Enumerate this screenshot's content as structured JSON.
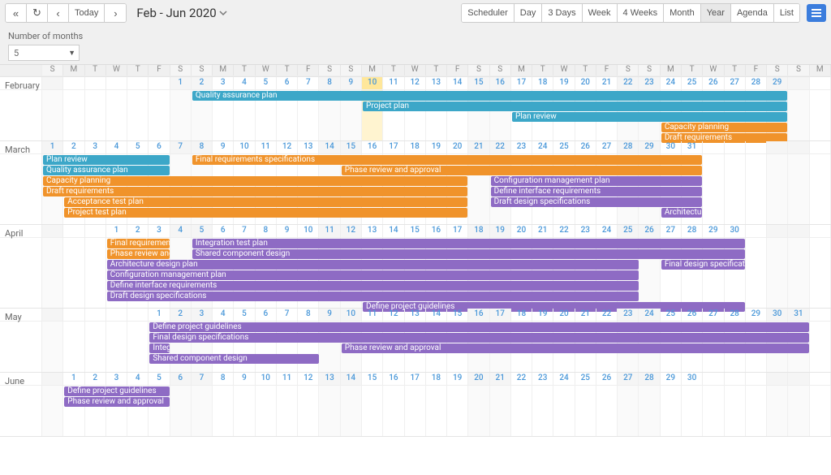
{
  "header": {
    "nav": {
      "first": "«",
      "prev": "‹",
      "today": "Today",
      "next": "›",
      "refresh": "↻"
    },
    "date_range": "Feb - Jun 2020",
    "views": [
      "Scheduler",
      "Day",
      "3 Days",
      "Week",
      "4 Weeks",
      "Month",
      "Year",
      "Agenda",
      "List"
    ],
    "active_view": "Year"
  },
  "subheader": {
    "label": "Number of months",
    "value": "5"
  },
  "weekdays": [
    "S",
    "M",
    "T",
    "W",
    "T",
    "F",
    "S"
  ],
  "colors": {
    "blue": "#3ca7c8",
    "orange": "#f0932b",
    "purple": "#8e6bc4",
    "today": "#ffe79a"
  },
  "months": [
    {
      "name": "February",
      "first_weekday": 6,
      "days": 29,
      "today": 10,
      "body_height": 62,
      "events": [
        {
          "label": "Quality assurance plan",
          "color": "blue",
          "start": 2,
          "end": 29,
          "row": 0
        },
        {
          "label": "Project plan",
          "color": "blue",
          "start": 10,
          "end": 29,
          "row": 1
        },
        {
          "label": "Plan review",
          "color": "blue",
          "start": 17,
          "end": 29,
          "row": 2
        },
        {
          "label": "Capacity planning",
          "color": "orange",
          "start": 24,
          "end": 29,
          "row": 3
        },
        {
          "label": "Draft requirements",
          "color": "orange",
          "start": 24,
          "end": 29,
          "row": 4
        }
      ]
    },
    {
      "name": "March",
      "first_weekday": 0,
      "days": 31,
      "today": null,
      "body_height": 86,
      "events": [
        {
          "label": "Plan review",
          "color": "blue",
          "start": 1,
          "end": 6,
          "row": 0
        },
        {
          "label": "Final requirements specifications",
          "color": "orange",
          "start": 8,
          "end": 31,
          "row": 0
        },
        {
          "label": "Quality assurance plan",
          "color": "blue",
          "start": 1,
          "end": 6,
          "row": 1
        },
        {
          "label": "Phase review and approval",
          "color": "orange",
          "start": 15,
          "end": 31,
          "row": 1
        },
        {
          "label": "Capacity planning",
          "color": "orange",
          "start": 1,
          "end": 20,
          "row": 2
        },
        {
          "label": "Configuration management plan",
          "color": "purple",
          "start": 22,
          "end": 31,
          "row": 2
        },
        {
          "label": "Draft requirements",
          "color": "orange",
          "start": 1,
          "end": 20,
          "row": 3
        },
        {
          "label": "Define interface requirements",
          "color": "purple",
          "start": 22,
          "end": 31,
          "row": 3
        },
        {
          "label": "Acceptance test plan",
          "color": "orange",
          "start": 2,
          "end": 20,
          "row": 4
        },
        {
          "label": "Draft design specifications",
          "color": "purple",
          "start": 22,
          "end": 31,
          "row": 4
        },
        {
          "label": "Project test plan",
          "color": "orange",
          "start": 2,
          "end": 20,
          "row": 5
        },
        {
          "label": "Architecture",
          "color": "purple",
          "start": 30,
          "end": 31,
          "row": 5
        }
      ]
    },
    {
      "name": "April",
      "first_weekday": 3,
      "days": 30,
      "today": null,
      "body_height": 86,
      "events": [
        {
          "label": "Final requirements",
          "color": "orange",
          "start": 1,
          "end": 3,
          "row": 0
        },
        {
          "label": "Integration test plan",
          "color": "purple",
          "start": 5,
          "end": 30,
          "row": 0
        },
        {
          "label": "Phase review and",
          "color": "orange",
          "start": 1,
          "end": 3,
          "row": 1
        },
        {
          "label": "Shared component design",
          "color": "purple",
          "start": 5,
          "end": 30,
          "row": 1
        },
        {
          "label": "Architecture design plan",
          "color": "purple",
          "start": 1,
          "end": 25,
          "row": 2
        },
        {
          "label": "Final design specifications",
          "color": "purple",
          "start": 27,
          "end": 30,
          "row": 2
        },
        {
          "label": "Configuration management plan",
          "color": "purple",
          "start": 1,
          "end": 25,
          "row": 3
        },
        {
          "label": "Define interface requirements",
          "color": "purple",
          "start": 1,
          "end": 25,
          "row": 4
        },
        {
          "label": "Draft design specifications",
          "color": "purple",
          "start": 1,
          "end": 25,
          "row": 5
        },
        {
          "label": "Define project guidelines",
          "color": "purple",
          "start": 13,
          "end": 30,
          "row": 6
        }
      ]
    },
    {
      "name": "May",
      "first_weekday": 5,
      "days": 31,
      "today": null,
      "body_height": 62,
      "events": [
        {
          "label": "Define project guidelines",
          "color": "purple",
          "start": 1,
          "end": 31,
          "row": 0
        },
        {
          "label": "Final design specifications",
          "color": "purple",
          "start": 1,
          "end": 31,
          "row": 1
        },
        {
          "label": "Integ",
          "color": "purple",
          "start": 1,
          "end": 1,
          "row": 2
        },
        {
          "label": "Phase review and approval",
          "color": "purple",
          "start": 10,
          "end": 31,
          "row": 2
        },
        {
          "label": "Shared component design",
          "color": "purple",
          "start": 1,
          "end": 8,
          "row": 3
        }
      ]
    },
    {
      "name": "June",
      "first_weekday": 1,
      "days": 30,
      "today": null,
      "body_height": 62,
      "events": [
        {
          "label": "Define project guidelines",
          "color": "purple",
          "start": 1,
          "end": 5,
          "row": 0
        },
        {
          "label": "Phase review and approval",
          "color": "purple",
          "start": 1,
          "end": 5,
          "row": 1
        }
      ]
    }
  ]
}
